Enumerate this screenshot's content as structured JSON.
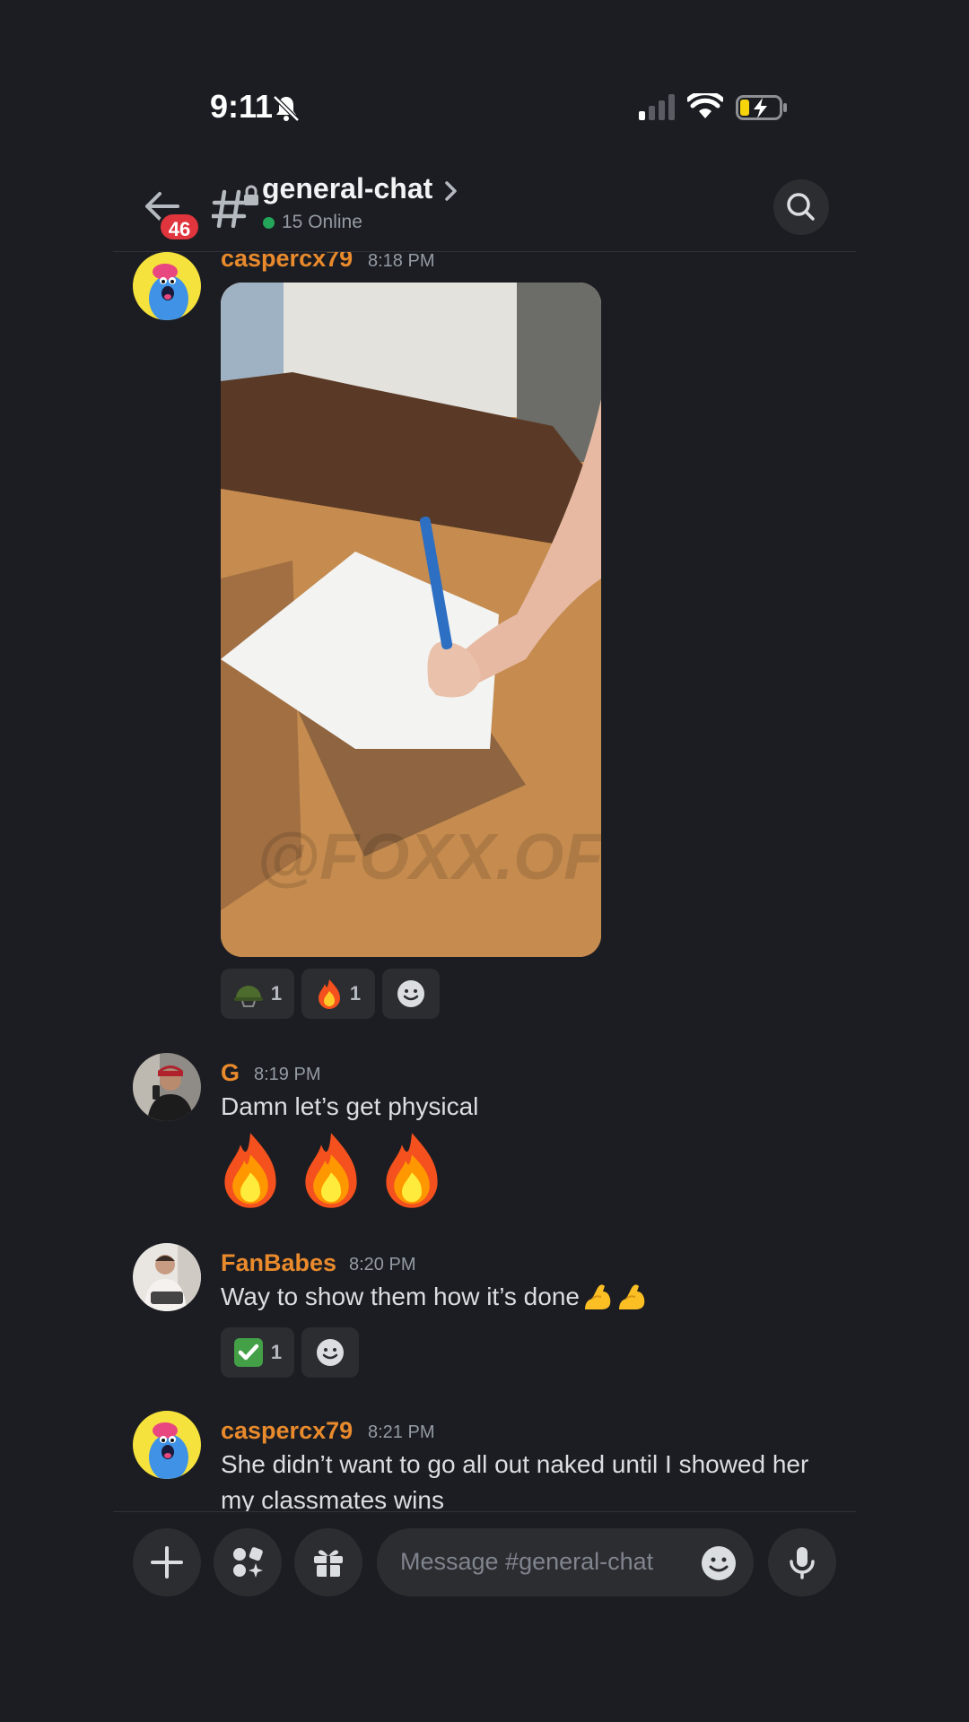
{
  "status_bar": {
    "time": "9:11",
    "bell_icon": "bell-slash-icon",
    "signal_icon": "cellular-signal-icon",
    "wifi_icon": "wifi-icon",
    "battery_icon": "battery-charging-icon"
  },
  "header": {
    "back_icon": "back-arrow-icon",
    "unread_badge": "46",
    "channel_icon": "locked-hash-icon",
    "channel_name": "general-chat",
    "online_count": "15 Online",
    "search_icon": "search-icon",
    "colors": {
      "online": "#23a55a",
      "badge": "#e0353d"
    }
  },
  "messages": [
    {
      "username": "caspercx79",
      "time": "8:18 PM",
      "attachment_icon": "photo-attachment",
      "watermark": "@FOXX.OFM",
      "reactions": [
        {
          "emoji_icon": "helmet-emoji",
          "count": "1"
        },
        {
          "emoji_icon": "fire-emoji",
          "count": "1"
        }
      ],
      "add_reaction_icon": "add-reaction-icon"
    },
    {
      "username": "G",
      "time": "8:19 PM",
      "text": "Damn let’s get physical",
      "big_emojis": [
        "fire-emoji",
        "fire-emoji",
        "fire-emoji"
      ]
    },
    {
      "username": "FanBabes",
      "time": "8:20 PM",
      "text": "Way to show them how it’s done",
      "inline_emojis": [
        "flexed-biceps-emoji",
        "flexed-biceps-emoji"
      ],
      "reactions": [
        {
          "emoji_icon": "check-mark-button-emoji",
          "count": "1"
        }
      ],
      "add_reaction_icon": "add-reaction-icon"
    },
    {
      "username": "caspercx79",
      "time": "8:21 PM",
      "text": "She didn’t want to go all out naked until I showed her my classmates wins"
    }
  ],
  "composer": {
    "placeholder": "Message #general-chat",
    "plus_icon": "plus-icon",
    "apps_icon": "apps-icon",
    "gift_icon": "gift-icon",
    "emoji_icon": "emoji-icon",
    "mic_icon": "microphone-icon"
  },
  "colors": {
    "background": "#1c1d22",
    "username": "#e98a2c",
    "surface": "#2b2d31"
  }
}
